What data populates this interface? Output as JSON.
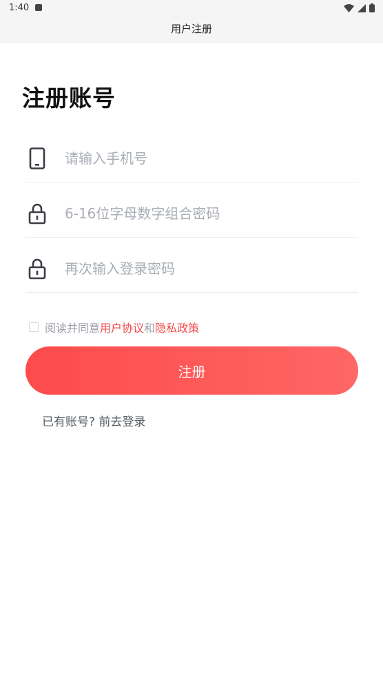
{
  "status_bar": {
    "time": "1:40"
  },
  "nav": {
    "title": "用户注册"
  },
  "page": {
    "title": "注册账号"
  },
  "form": {
    "phone_placeholder": "请输入手机号",
    "password_placeholder": "6-16位字母数字组合密码",
    "confirm_placeholder": "再次输入登录密码"
  },
  "agreement": {
    "prefix": "阅读并同意",
    "user_agreement": "用户协议",
    "conjunction": "和",
    "privacy_policy": "隐私政策",
    "checked": false
  },
  "actions": {
    "register_label": "注册",
    "login_link": "已有账号? 前去登录"
  },
  "colors": {
    "accent": "#fd4b4b",
    "accent_end": "#ff6666",
    "link": "#f24b4b",
    "placeholder": "#a9adb5"
  },
  "icons": {
    "phone": "phone-icon",
    "lock": "lock-icon",
    "wifi": "wifi-icon",
    "signal": "signal-icon",
    "battery": "battery-icon"
  }
}
